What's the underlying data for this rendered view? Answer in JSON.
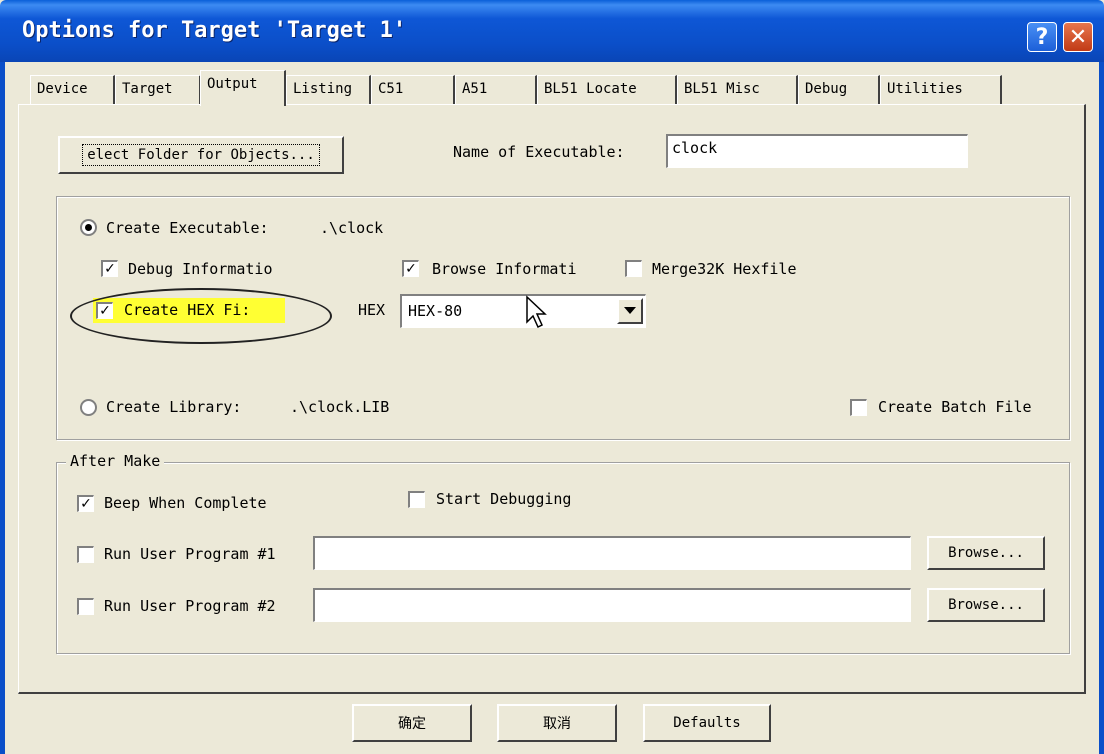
{
  "window": {
    "title": "Options for Target 'Target 1'",
    "help_symbol": "?",
    "close_symbol": "✕"
  },
  "tabs": [
    {
      "label": "Device"
    },
    {
      "label": "Target"
    },
    {
      "label": "Output",
      "active": true
    },
    {
      "label": "Listing"
    },
    {
      "label": "C51"
    },
    {
      "label": "A51"
    },
    {
      "label": "BL51 Locate"
    },
    {
      "label": "BL51 Misc"
    },
    {
      "label": "Debug"
    },
    {
      "label": "Utilities"
    }
  ],
  "output": {
    "select_folder_label": "elect Folder for Objects...",
    "name_exec_label": "Name of Executable:",
    "name_exec_value": "clock",
    "create_exec_label": "Create Executable:",
    "create_exec_path": ".\\clock",
    "create_exec_selected": true,
    "debug_info_label": "Debug Informatio",
    "debug_info_checked": true,
    "browse_info_label": "Browse Informati",
    "browse_info_checked": true,
    "merge_hex_label": "Merge32K Hexfile",
    "merge_hex_checked": false,
    "create_hex_label": "Create HEX Fi:",
    "create_hex_checked": true,
    "hex_label": "HEX",
    "hex_format_value": "HEX-80",
    "create_library_label": "Create Library:",
    "create_library_path": ".\\clock.LIB",
    "create_library_selected": false,
    "create_batch_label": "Create Batch File",
    "create_batch_checked": false
  },
  "after_make": {
    "title": "After Make",
    "beep_label": "Beep When Complete",
    "beep_checked": true,
    "start_debug_label": "Start Debugging",
    "start_debug_checked": false,
    "run1_label": "Run User Program #1",
    "run1_checked": false,
    "run1_value": "",
    "run2_label": "Run User Program #2",
    "run2_checked": false,
    "run2_value": "",
    "browse_label": "Browse..."
  },
  "footer": {
    "ok_label": "确定",
    "cancel_label": "取消",
    "defaults_label": "Defaults"
  },
  "colors": {
    "titlebar": "#0b4fc9",
    "dialog_bg": "#ece9d8",
    "highlight": "#ffff33"
  }
}
